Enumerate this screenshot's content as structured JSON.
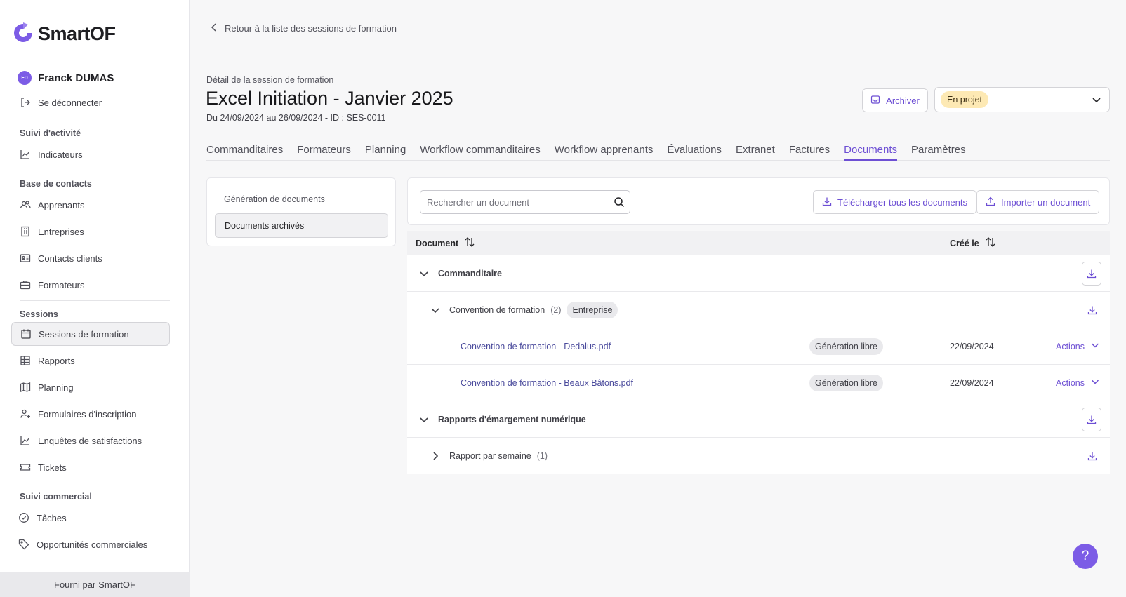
{
  "app": {
    "logo_text": "SmartOF",
    "brand_color": "#7c5ce6"
  },
  "user": {
    "initials": "FD",
    "name": "Franck DUMAS",
    "logout_label": "Se déconnecter"
  },
  "sidebar": {
    "sections": [
      {
        "title": "Suivi d'activité",
        "items": [
          {
            "label": "Indicateurs",
            "icon": "chart-line-icon"
          }
        ]
      },
      {
        "title": "Base de contacts",
        "items": [
          {
            "label": "Apprenants",
            "icon": "users-icon"
          },
          {
            "label": "Entreprises",
            "icon": "building-icon"
          },
          {
            "label": "Contacts clients",
            "icon": "contact-card-icon"
          },
          {
            "label": "Formateurs",
            "icon": "briefcase-icon"
          }
        ]
      },
      {
        "title": "Sessions",
        "items": [
          {
            "label": "Sessions de formation",
            "icon": "calendar-icon",
            "active": true
          },
          {
            "label": "Rapports",
            "icon": "table-icon"
          },
          {
            "label": "Planning",
            "icon": "map-icon"
          },
          {
            "label": "Formulaires d'inscription",
            "icon": "user-add-icon"
          },
          {
            "label": "Enquêtes de satisfactions",
            "icon": "chart-line-icon"
          },
          {
            "label": "Tickets",
            "icon": "ticket-icon"
          }
        ]
      },
      {
        "title": "Suivi commercial",
        "items": [
          {
            "label": "Tâches",
            "icon": "check-circle-icon"
          },
          {
            "label": "Opportunités commerciales",
            "icon": "tag-icon"
          }
        ]
      }
    ],
    "footer_text": "Fourni par",
    "footer_link": "SmartOF"
  },
  "header": {
    "back_label": "Retour à la liste des sessions de formation",
    "subtitle": "Détail de la session de formation",
    "title": "Excel Initiation - Janvier 2025",
    "dates": "Du 24/09/2024 au 26/09/2024 - ID : SES-0011",
    "archive_label": "Archiver",
    "status_value": "En projet"
  },
  "tabs": [
    {
      "label": "Commanditaires"
    },
    {
      "label": "Formateurs"
    },
    {
      "label": "Planning"
    },
    {
      "label": "Workflow commanditaires"
    },
    {
      "label": "Workflow apprenants"
    },
    {
      "label": "Évaluations"
    },
    {
      "label": "Extranet"
    },
    {
      "label": "Factures"
    },
    {
      "label": "Documents",
      "active": true
    },
    {
      "label": "Paramètres"
    }
  ],
  "left_panel": {
    "items": [
      {
        "label": "Génération de documents"
      },
      {
        "label": "Documents archivés",
        "active": true
      }
    ]
  },
  "toolbar": {
    "search_placeholder": "Rechercher un document",
    "download_all_label": "Télécharger tous les documents",
    "import_label": "Importer un document"
  },
  "table": {
    "col_document": "Document",
    "col_created": "Créé le",
    "groups": [
      {
        "label": "Commanditaire",
        "subgroups": [
          {
            "label": "Convention de formation",
            "count": "(2)",
            "tag": "Entreprise",
            "expanded": true,
            "files": [
              {
                "name": "Convention de formation - Dedalus.pdf",
                "tag": "Génération libre",
                "date": "22/09/2024",
                "actions": "Actions"
              },
              {
                "name": "Convention de formation - Beaux Bâtons.pdf",
                "tag": "Génération libre",
                "date": "22/09/2024",
                "actions": "Actions"
              }
            ]
          }
        ]
      },
      {
        "label": "Rapports d'émargement numérique",
        "subgroups": [
          {
            "label": "Rapport par semaine",
            "count": "(1)",
            "expanded": false,
            "files": []
          }
        ]
      }
    ]
  },
  "help_label": "?"
}
